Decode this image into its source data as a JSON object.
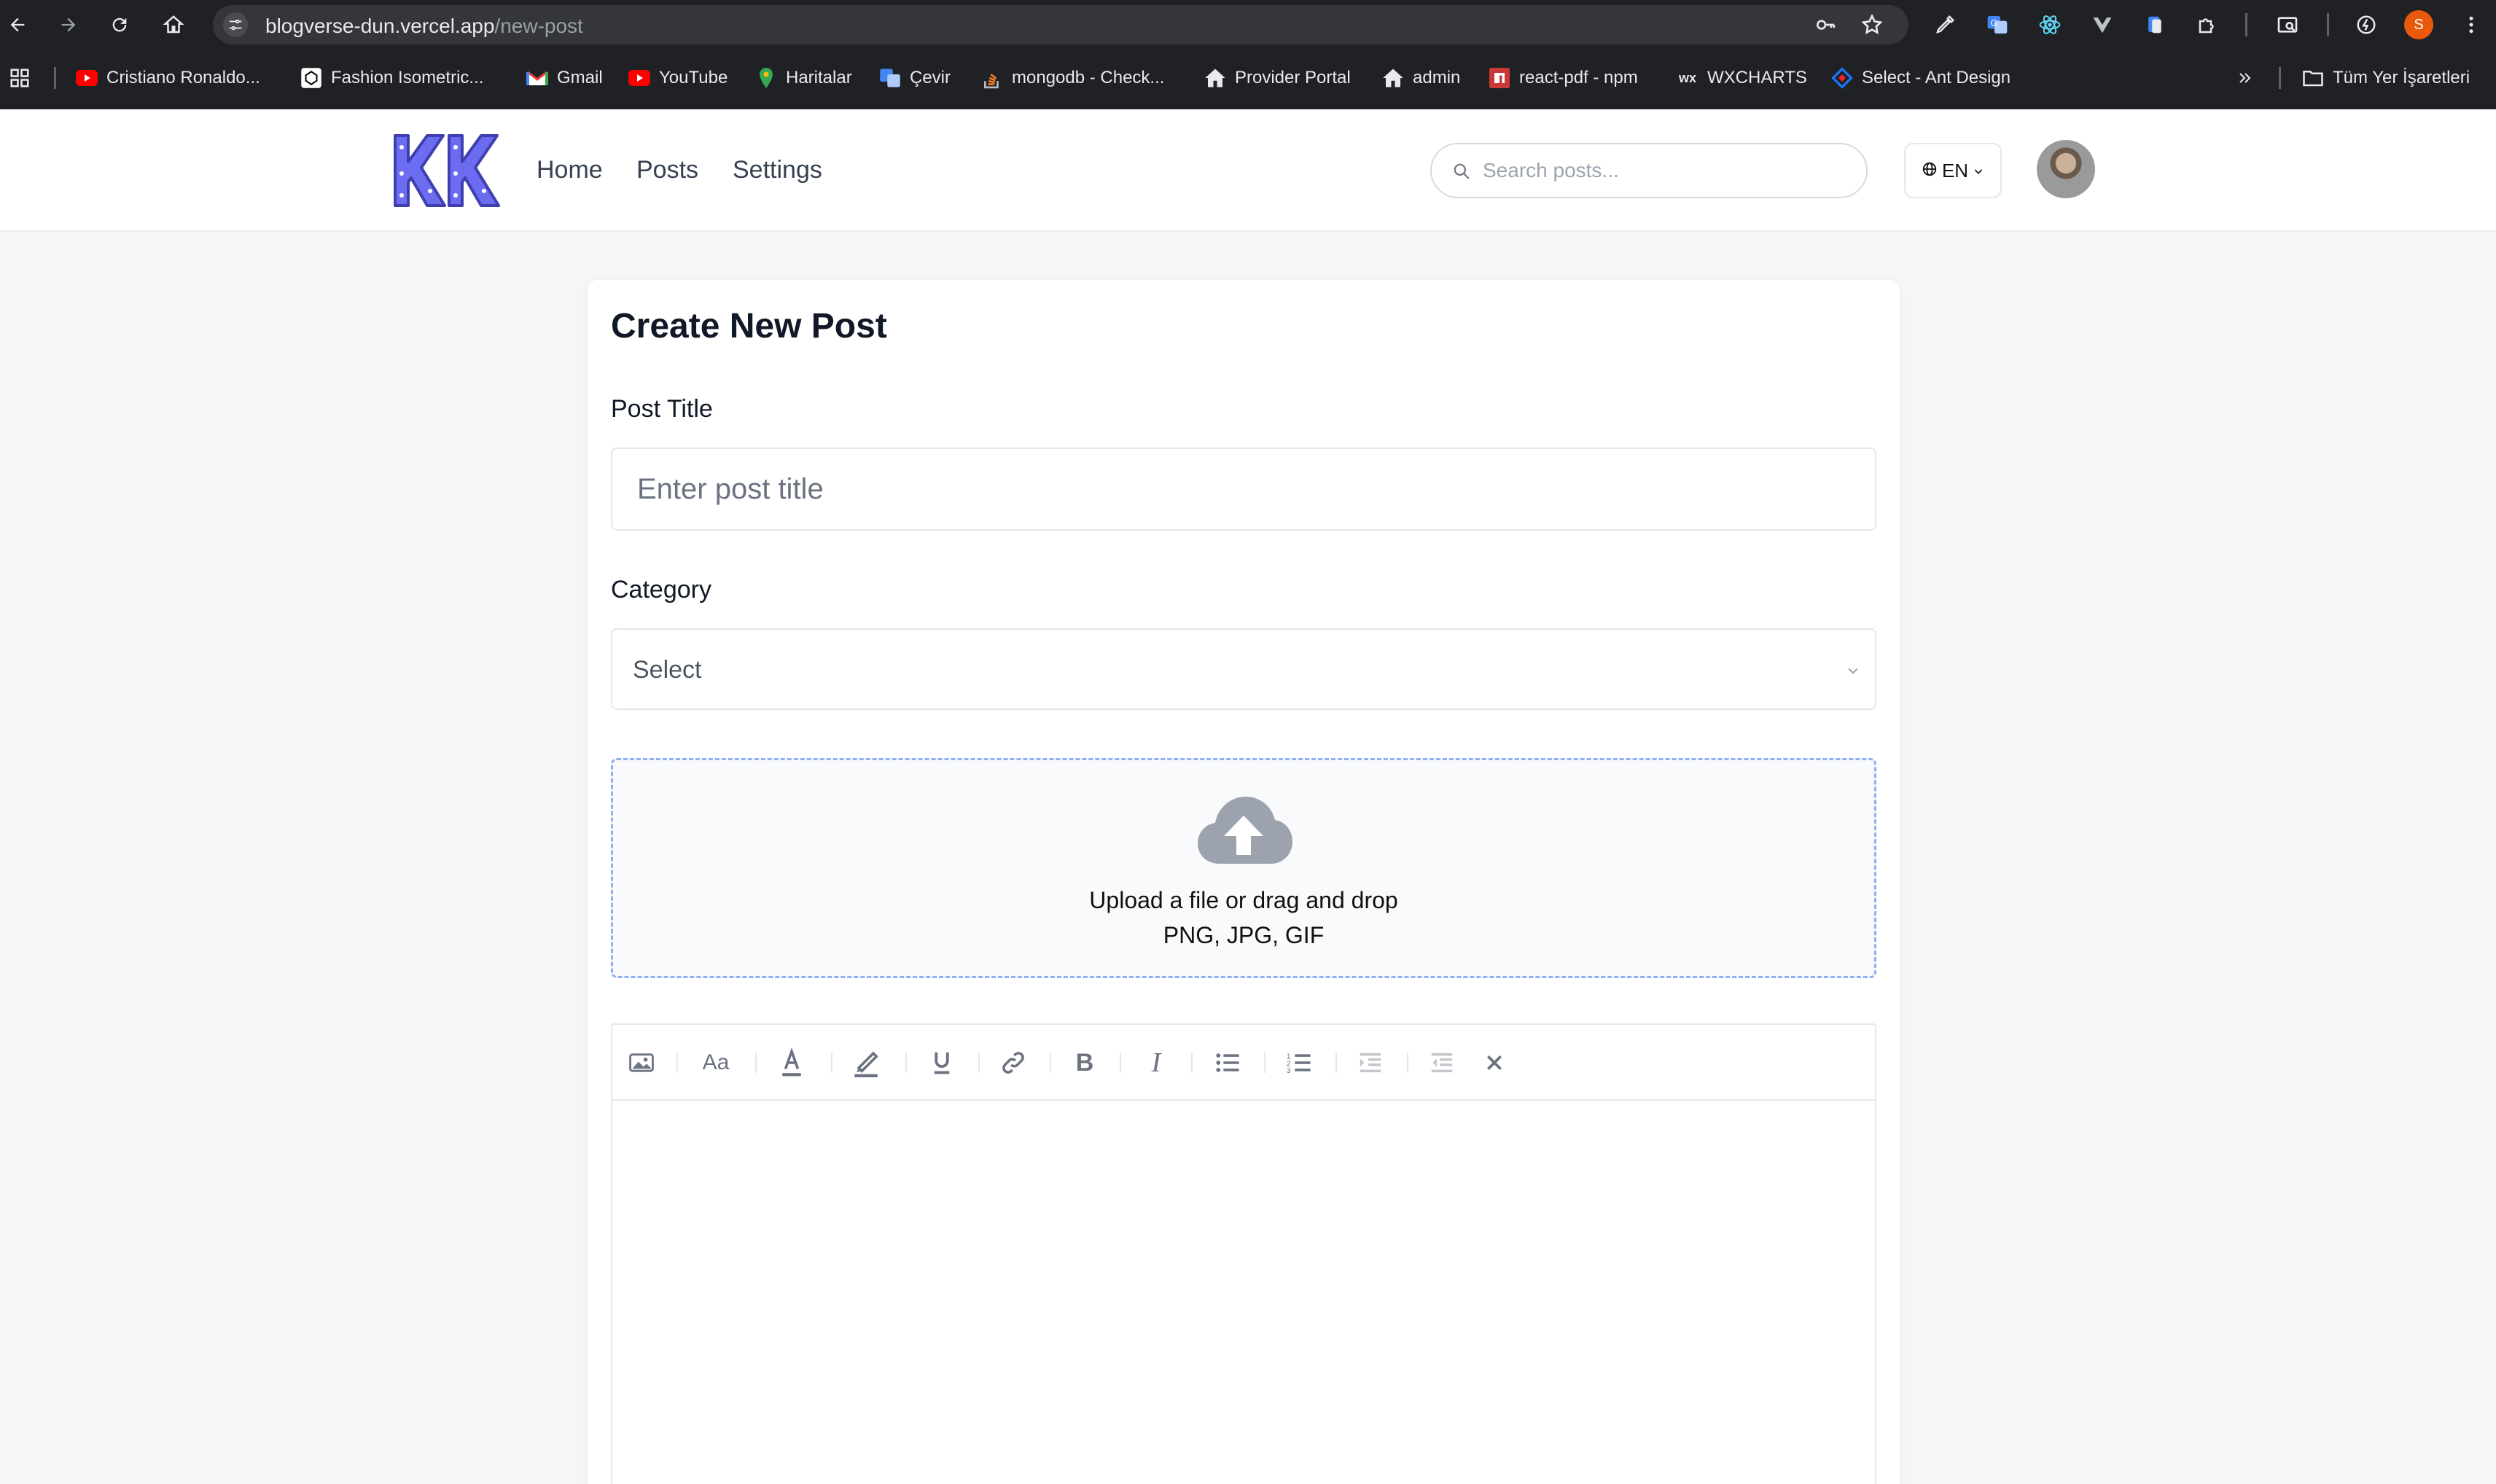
{
  "browser": {
    "url_host": "blogverse-dun.vercel.app",
    "url_path": "/new-post",
    "profile_initial": "S",
    "bookmarks": [
      {
        "label": "Cristiano Ronaldo...",
        "icon": "youtube-icon"
      },
      {
        "label": "Fashion Isometric...",
        "icon": "codepen-icon"
      },
      {
        "label": "Gmail",
        "icon": "gmail-icon"
      },
      {
        "label": "YouTube",
        "icon": "youtube-icon"
      },
      {
        "label": "Haritalar",
        "icon": "maps-pin-icon"
      },
      {
        "label": "Çevir",
        "icon": "translate-icon"
      },
      {
        "label": "mongodb - Check...",
        "icon": "stackoverflow-icon"
      },
      {
        "label": "Provider Portal",
        "icon": "home-icon"
      },
      {
        "label": "admin",
        "icon": "home-icon"
      },
      {
        "label": "react-pdf - npm",
        "icon": "npm-icon"
      },
      {
        "label": "WXCHARTS",
        "icon": "wx-icon"
      },
      {
        "label": "Select - Ant Design",
        "icon": "antd-icon"
      }
    ],
    "all_bookmarks_label": "Tüm Yer İşaretleri"
  },
  "header": {
    "nav": [
      "Home",
      "Posts",
      "Settings"
    ],
    "search_placeholder": "Search posts...",
    "language": "EN"
  },
  "form": {
    "heading": "Create New Post",
    "title_label": "Post Title",
    "title_placeholder": "Enter post title",
    "category_label": "Category",
    "category_value": "Select",
    "upload_line1": "Upload a file or drag and drop",
    "upload_line2": "PNG, JPG, GIF"
  },
  "editor_toolbar": [
    "image-icon",
    "font-size-icon",
    "text-color-icon",
    "highlight-icon",
    "underline-icon",
    "link-icon",
    "bold-icon",
    "italic-icon",
    "bullet-list-icon",
    "numbered-list-icon",
    "indent-icon",
    "outdent-icon",
    "clear-format-icon"
  ],
  "colors": {
    "accent": "#5b5bd6",
    "upload_border": "#8fb0f5",
    "chrome_bg": "#202124"
  }
}
